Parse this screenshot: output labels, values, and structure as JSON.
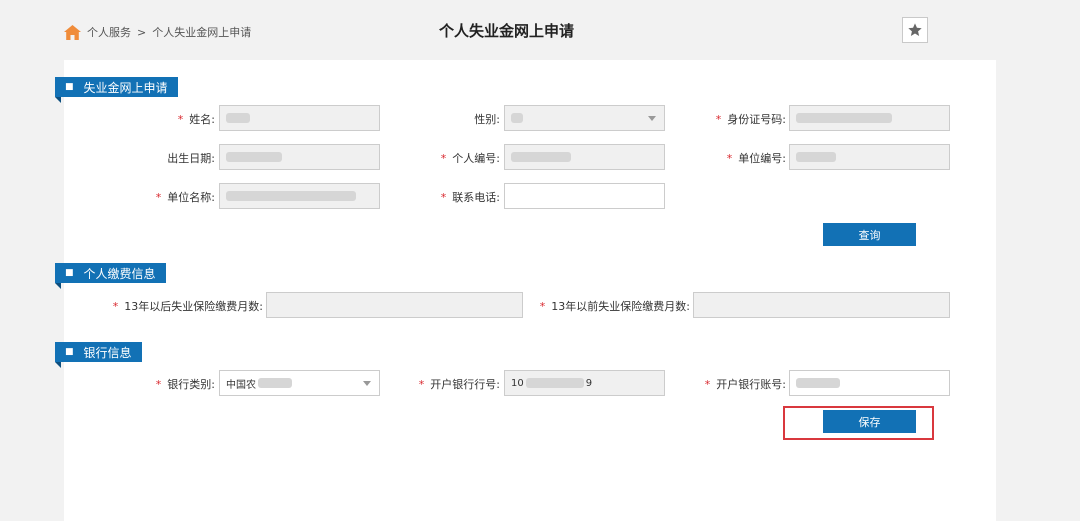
{
  "breadcrumb": {
    "home": "个人服务",
    "separator": ">",
    "current": "个人失业金网上申请"
  },
  "page_title": "个人失业金网上申请",
  "sections": {
    "apply": "失业金网上申请",
    "payment": "个人缴费信息",
    "bank": "银行信息"
  },
  "form": {
    "name": {
      "label": "姓名:",
      "value": ""
    },
    "gender": {
      "label": "性别:",
      "value": ""
    },
    "id_number": {
      "label": "身份证号码:",
      "value": ""
    },
    "birth_date": {
      "label": "出生日期:",
      "value": ""
    },
    "person_no": {
      "label": "个人编号:",
      "value": ""
    },
    "unit_no": {
      "label": "单位编号:",
      "value": ""
    },
    "unit_name": {
      "label": "单位名称:",
      "value": ""
    },
    "phone": {
      "label": "联系电话:",
      "value": ""
    },
    "query_button": "查询",
    "months_after_13": {
      "label": "13年以后失业保险缴费月数:",
      "value": ""
    },
    "months_before_13": {
      "label": "13年以前失业保险缴费月数:",
      "value": ""
    },
    "bank_type": {
      "label": "银行类别:",
      "value": "中国农"
    },
    "bank_code": {
      "label": "开户银行行号:",
      "value": "10",
      "suffix": "9"
    },
    "bank_account": {
      "label": "开户银行账号:",
      "value": ""
    },
    "save_button": "保存"
  },
  "colors": {
    "accent": "#1271b5",
    "required": "#d9272e",
    "highlight": "#d9383e",
    "home_icon": "#f08c3a"
  },
  "icons": {
    "home": "home-icon",
    "star": "star-icon",
    "dropdown": "chevron-down-icon"
  }
}
